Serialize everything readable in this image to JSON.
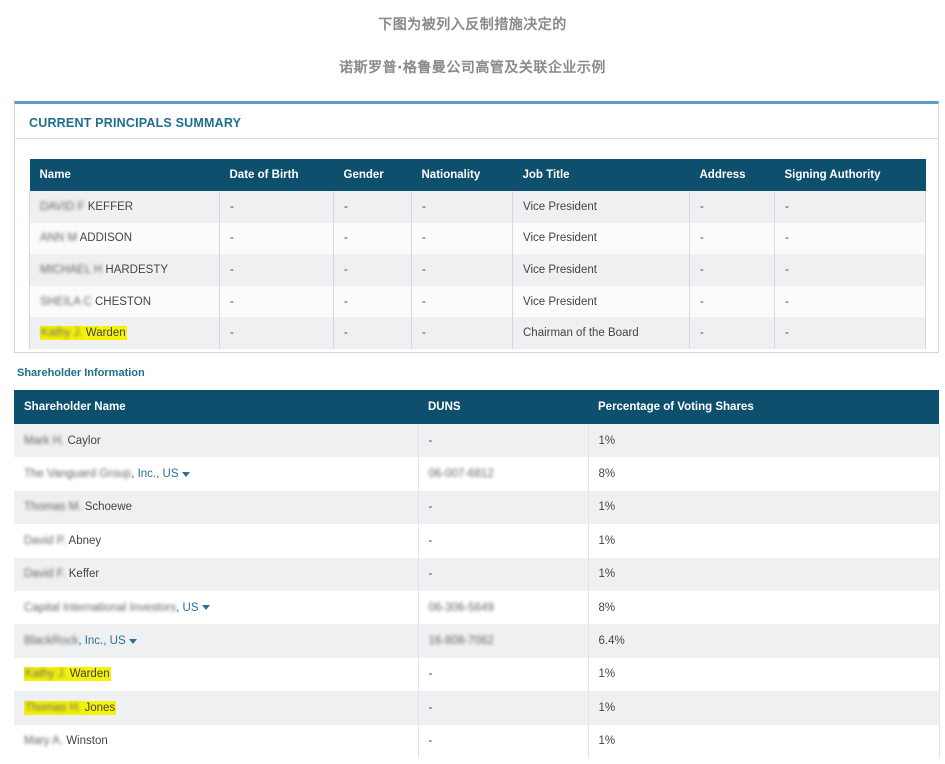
{
  "captions": {
    "line1": "下图为被列入反制措施决定的",
    "line2": "诺斯罗普·格鲁曼公司高管及关联企业示例"
  },
  "principals": {
    "title": "CURRENT PRINCIPALS SUMMARY",
    "columns": [
      "Name",
      "Date of Birth",
      "Gender",
      "Nationality",
      "Job Title",
      "Address",
      "Signing Authority"
    ],
    "rows": [
      {
        "name_blur": "DAVID F",
        "name": "KEFFER",
        "dob": "-",
        "gender": "-",
        "nationality": "-",
        "job": "Vice President",
        "address": "-",
        "signing": "-",
        "highlight": false
      },
      {
        "name_blur": "ANN M",
        "name": "ADDISON",
        "dob": "-",
        "gender": "-",
        "nationality": "-",
        "job": "Vice President",
        "address": "-",
        "signing": "-",
        "highlight": false
      },
      {
        "name_blur": "MICHAEL H",
        "name": "HARDESTY",
        "dob": "-",
        "gender": "-",
        "nationality": "-",
        "job": "Vice President",
        "address": "-",
        "signing": "-",
        "highlight": false
      },
      {
        "name_blur": "SHEILA C",
        "name": "CHESTON",
        "dob": "-",
        "gender": "-",
        "nationality": "-",
        "job": "Vice President",
        "address": "-",
        "signing": "-",
        "highlight": false
      },
      {
        "name_blur": "Kathy J.",
        "name": "Warden",
        "dob": "-",
        "gender": "-",
        "nationality": "-",
        "job": "Chairman of the Board",
        "address": "-",
        "signing": "-",
        "highlight": true
      }
    ]
  },
  "shareholders": {
    "title": "Shareholder Information",
    "columns": [
      "Shareholder Name",
      "DUNS",
      "Percentage of Voting Shares"
    ],
    "rows": [
      {
        "name_blur": "Mark H.",
        "name": "Caylor",
        "duns": "-",
        "duns_blur": false,
        "pct": "1%",
        "link": false,
        "highlight": false
      },
      {
        "name_blur": "The Vanguard Group",
        "name": ", Inc., US",
        "duns": "06-007-6812",
        "duns_blur": true,
        "pct": "8%",
        "link": true,
        "highlight": false
      },
      {
        "name_blur": "Thomas M.",
        "name": "Schoewe",
        "duns": "-",
        "duns_blur": false,
        "pct": "1%",
        "link": false,
        "highlight": false
      },
      {
        "name_blur": "David P.",
        "name": "Abney",
        "duns": "-",
        "duns_blur": false,
        "pct": "1%",
        "link": false,
        "highlight": false
      },
      {
        "name_blur": "David F.",
        "name": "Keffer",
        "duns": "-",
        "duns_blur": false,
        "pct": "1%",
        "link": false,
        "highlight": false
      },
      {
        "name_blur": "Capital International Investors",
        "name": ", US",
        "duns": "06-306-5649",
        "duns_blur": true,
        "pct": "8%",
        "link": true,
        "highlight": false
      },
      {
        "name_blur": "BlackRock",
        "name": ", Inc., US",
        "duns": "16-808-7062",
        "duns_blur": true,
        "pct": "6.4%",
        "link": true,
        "highlight": false
      },
      {
        "name_blur": "Kathy J.",
        "name": "Warden",
        "duns": "-",
        "duns_blur": false,
        "pct": "1%",
        "link": false,
        "highlight": true
      },
      {
        "name_blur": "Thomas H.",
        "name": "Jones",
        "duns": "-",
        "duns_blur": false,
        "pct": "1%",
        "link": false,
        "highlight": true
      },
      {
        "name_blur": "Mary A.",
        "name": "Winston",
        "duns": "-",
        "duns_blur": false,
        "pct": "1%",
        "link": false,
        "highlight": false
      }
    ]
  },
  "colors": {
    "header_bg": "#0e4f6e",
    "title_color": "#1f6e8c",
    "panel_top_border": "#5b9fc9",
    "highlight": "#f4f10a",
    "link": "#2b6f9e"
  },
  "icons": {
    "dropdown": "caret-down-icon"
  }
}
